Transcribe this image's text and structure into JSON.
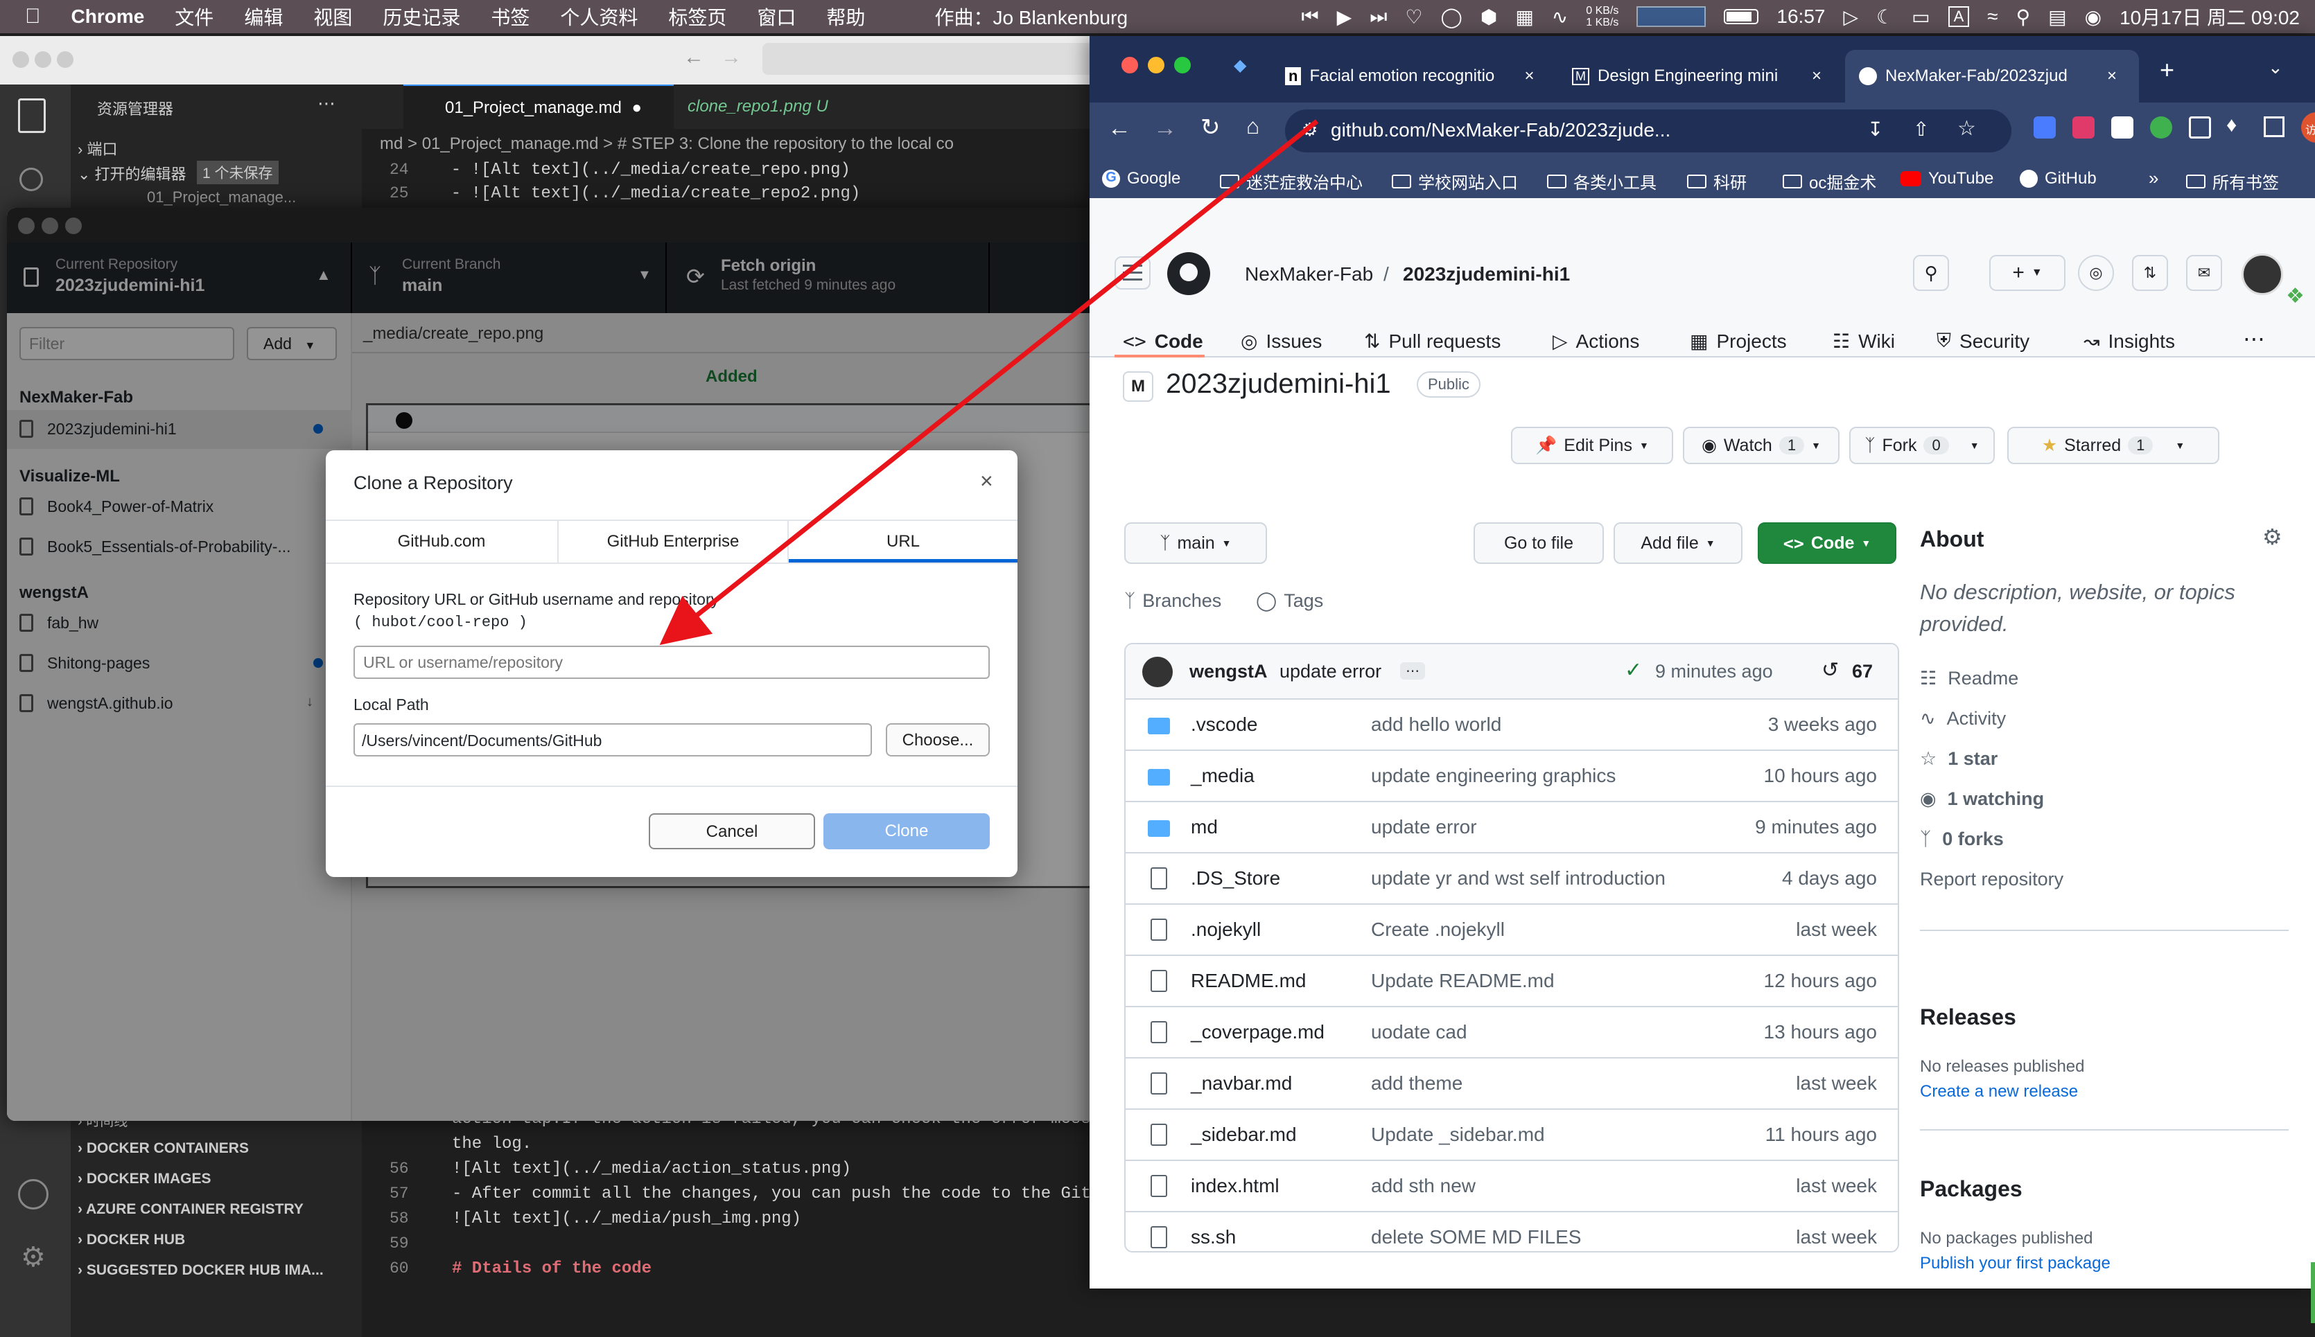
{
  "menubar": {
    "app": "Chrome",
    "items": [
      "文件",
      "编辑",
      "视图",
      "历史记录",
      "书签",
      "个人资料",
      "标签页",
      "窗口",
      "帮助"
    ],
    "song": "作曲：Jo Blankenburg",
    "net_up": "0 KB/s",
    "net_down": "1 KB/s",
    "clock1": "16:57",
    "datetime": "10月17日 周二  09:02"
  },
  "vscode": {
    "explorer_title": "资源管理器",
    "port": "端口",
    "open_editors": "打开的编辑器",
    "unsaved": "1 个未保存",
    "open_file_partial": "01_Project_manage...",
    "tab1": "01_Project_manage.md",
    "tab2": "clone_repo1.png",
    "tab2_status": "U",
    "breadcrumb": "md  >  01_Project_manage.md  >  # STEP 3: Clone the repository to the local co",
    "timeline": "时间线",
    "docker": [
      "DOCKER CONTAINERS",
      "DOCKER IMAGES",
      "AZURE CONTAINER REGISTRY",
      "DOCKER HUB",
      "SUGGESTED DOCKER HUB IMA..."
    ],
    "top_lines": [
      {
        "n": "24",
        "code": "  - ![Alt text](../_media/create_repo.png)"
      },
      {
        "n": "25",
        "code": "  - ![Alt text](../_media/create_repo2.png)"
      }
    ],
    "bottom_lines": [
      {
        "n": "",
        "code": "action tap.If the action is failed, you can check the error mess"
      },
      {
        "n": "",
        "code": "the log."
      },
      {
        "n": "56",
        "code": "![Alt text](../_media/action_status.png)"
      },
      {
        "n": "57",
        "code": "- After commit all the changes, you can push the code to the Git"
      },
      {
        "n": "58",
        "code": "![Alt text](../_media/push_img.png)"
      },
      {
        "n": "59",
        "code": ""
      },
      {
        "n": "60",
        "code": "# Dtails of the code"
      }
    ]
  },
  "ghdesktop": {
    "current_repo_label": "Current Repository",
    "current_repo": "2023zjudemini-hi1",
    "branch_label": "Current Branch",
    "branch": "main",
    "fetch_label": "Fetch origin",
    "fetch_sub": "Last fetched 9 minutes ago",
    "filter_placeholder": "Filter",
    "add_label": "Add",
    "groups": [
      {
        "name": "NexMaker-Fab",
        "repos": [
          "2023zjudemini-hi1"
        ]
      },
      {
        "name": "Visualize-ML",
        "repos": [
          "Book4_Power-of-Matrix",
          "Book5_Essentials-of-Probability-..."
        ]
      },
      {
        "name": "wengstA",
        "repos": [
          "fab_hw",
          "Shitong-pages",
          "wengstA.github.io"
        ]
      }
    ],
    "diff_path": "_media/create_repo.png",
    "diff_status": "Added"
  },
  "clone_dialog": {
    "title": "Clone a Repository",
    "tabs": [
      "GitHub.com",
      "GitHub Enterprise",
      "URL"
    ],
    "url_label": "Repository URL or GitHub username and repository",
    "url_hint": "( hubot/cool-repo )",
    "url_placeholder": "URL or username/repository",
    "local_path_label": "Local Path",
    "local_path": "/Users/vincent/Documents/GitHub",
    "choose": "Choose...",
    "cancel": "Cancel",
    "clone": "Clone"
  },
  "chrome": {
    "tabs": [
      "Facial emotion recognitio",
      "Design Engineering mini",
      "NexMaker-Fab/2023zjud"
    ],
    "url": "github.com/NexMaker-Fab/2023zjude...",
    "bookmarks": [
      "Google",
      "迷茫症救治中心",
      "学校网站入口",
      "各类小工具",
      "科研",
      "oc掘金术",
      "YouTube",
      "GitHub"
    ],
    "all_bookmarks": "所有书签",
    "profile": "访客"
  },
  "github": {
    "owner": "NexMaker-Fab",
    "repo": "2023zjudemini-hi1",
    "nav": [
      "Code",
      "Issues",
      "Pull requests",
      "Actions",
      "Projects",
      "Wiki",
      "Security",
      "Insights"
    ],
    "visibility": "Public",
    "edit_pins": "Edit Pins",
    "watch": "Watch",
    "watch_count": "1",
    "fork": "Fork",
    "fork_count": "0",
    "starred": "Starred",
    "star_count": "1",
    "branch": "main",
    "branches": "Branches",
    "tags": "Tags",
    "go_to_file": "Go to file",
    "add_file": "Add file",
    "code_btn": "Code",
    "commit_user": "wengstA",
    "commit_msg": "update error",
    "commit_time": "9 minutes ago",
    "commit_count": "67",
    "files": [
      {
        "name": ".vscode",
        "type": "dir",
        "msg": "add hello world",
        "time": "3 weeks ago"
      },
      {
        "name": "_media",
        "type": "dir",
        "msg": "update engineering graphics",
        "time": "10 hours ago"
      },
      {
        "name": "md",
        "type": "dir",
        "msg": "update error",
        "time": "9 minutes ago"
      },
      {
        "name": ".DS_Store",
        "type": "file",
        "msg": "update yr and wst self introduction",
        "time": "4 days ago"
      },
      {
        "name": ".nojekyll",
        "type": "file",
        "msg": "Create .nojekyll",
        "time": "last week"
      },
      {
        "name": "README.md",
        "type": "file",
        "msg": "Update README.md",
        "time": "12 hours ago"
      },
      {
        "name": "_coverpage.md",
        "type": "file",
        "msg": "uodate cad",
        "time": "13 hours ago"
      },
      {
        "name": "_navbar.md",
        "type": "file",
        "msg": "add theme",
        "time": "last week"
      },
      {
        "name": "_sidebar.md",
        "type": "file",
        "msg": "Update _sidebar.md",
        "time": "11 hours ago"
      },
      {
        "name": "index.html",
        "type": "file",
        "msg": "add sth new",
        "time": "last week"
      },
      {
        "name": "ss.sh",
        "type": "file",
        "msg": "delete SOME MD FILES",
        "time": "last week"
      }
    ],
    "about_title": "About",
    "about_desc": "No description, website, or topics provided.",
    "readme": "Readme",
    "activity": "Activity",
    "stars": "1 star",
    "watching": "1 watching",
    "forks": "0 forks",
    "report": "Report repository",
    "releases_title": "Releases",
    "releases_none": "No releases published",
    "releases_link": "Create a new release",
    "packages_title": "Packages",
    "packages_none": "No packages published",
    "packages_link": "Publish your first package"
  },
  "colors": {
    "accent": "#1f883d",
    "link": "#0969da",
    "arrow": "#e8141a",
    "chrome_tab": "#1f2f55"
  }
}
